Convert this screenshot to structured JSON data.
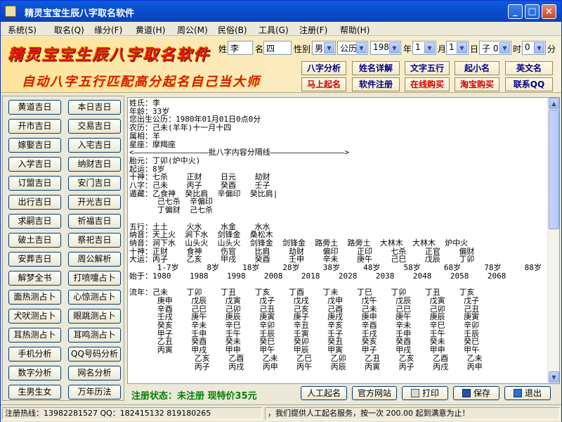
{
  "window": {
    "title": "精灵宝宝生辰八字取名软件"
  },
  "menu": [
    "系统(S)",
    "取名(Q)",
    "缘分(F)",
    "黄道(H)",
    "周公(M)",
    "民俗(B)",
    "工具(G)",
    "注册(F)",
    "帮助(H)"
  ],
  "banner": {
    "title": "精灵宝宝生辰八字取名软件",
    "subtitle": "自动八字五行匹配高分起名自己当大师"
  },
  "form": {
    "surname_label": "姓",
    "surname": "李",
    "name_label": "名",
    "name": "四",
    "gender_label": "性别",
    "gender": "男",
    "calendar": "公历",
    "year": "1980",
    "year_label": "年",
    "month": "1",
    "month_label": "月",
    "day": "1",
    "day_label": "日",
    "hour": "子 0",
    "hour_label": "时",
    "minute": "0",
    "minute_label": "分"
  },
  "actions": {
    "row1": [
      "八字分析",
      "姓名详解",
      "文字五行",
      "起小名",
      "英文名"
    ],
    "row2": [
      "马上起名",
      "软件注册",
      "在线购买",
      "淘宝购买",
      "联系QQ"
    ]
  },
  "left_buttons": [
    [
      "黄道吉日",
      "本日吉日"
    ],
    [
      "开市吉日",
      "交易吉日"
    ],
    [
      "嫁娶吉日",
      "入宅吉日"
    ],
    [
      "入学吉日",
      "纳财吉日"
    ],
    [
      "订盟吉日",
      "安门吉日"
    ],
    [
      "出行吉日",
      "开光吉日"
    ],
    [
      "求嗣吉日",
      "祈福吉日"
    ],
    [
      "破土吉日",
      "祭祀吉日"
    ],
    [
      "安葬吉日",
      "周公解析"
    ],
    [
      "解梦全书",
      "打喷嚏占卜"
    ],
    [
      "面热测占卜",
      "心惊测占卜"
    ],
    [
      "犬吠测占卜",
      "眼跳测占卜"
    ],
    [
      "耳热测占卜",
      "耳鸣测占卜"
    ],
    [
      "手机分析",
      "QQ号码分析"
    ],
    [
      "数字分析",
      "网名分析"
    ],
    [
      "生男生女",
      "万年历法"
    ]
  ],
  "result_text": "姓氏：李\n年龄：33岁\n您出生公历：1980年01月01日0点0分\n农历：己未(羊年)十一月十四\n属相：羊\n星座：摩羯座\n<————————————————批八字内容分隔线————————————————>\n胎元：丁卯(炉中火)\n起运：8岁\n十神：七杀    正财    日元    劫财\n八字：己未    丙子    癸酉    壬子\n遁藏：乙食神  癸比肩  辛偏印  癸比肩|\n      己七杀  辛偏印\n      丁偏财  己七杀\n\n五行：土土    火水    水金    水水\n纳音：天上火  涧下水  剑锋金  桑松木\n纳音：涧下水  山头火  山头火  剑锋金  剑锋金  路旁土  路旁土  大林木  大林木  炉中火\n十神：正财    食神    伤官    比肩    劫财    偏印    正印    七杀    正官    偏财\n大运：丙子    乙亥    甲戌    癸酉    壬申    辛未    庚午    己巳    戊辰    丁卯\n      1-7岁      8岁     18岁     28岁     38岁     48岁     58岁     68岁     78岁     88岁\n始于：1980    1988    1998    2008    2018    2028    2038    2048    2058    2068\n\n流年：己未    丁卯    丁丑    丁亥    丁酉    丁未    丁巳    丁卯    丁丑    丁亥\n      庚申    戊辰    戊寅    戊子    戊戌    戊申    戊午    戊辰    戊寅    戊子\n      辛酉    己巳    己卯    己丑    己亥    己酉    己未    己巳    己卯    己丑\n      壬戌    庚午    庚辰    庚寅    庚子    庚戌    庚申    庚午    庚辰    庚寅\n      癸亥    辛未    辛巳    辛卯    辛丑    辛亥    辛酉    辛未    辛巳    辛卯\n      甲子    壬申    壬午    壬辰    壬寅    壬子    壬戌    壬申    壬午    壬辰\n      乙丑    癸酉    癸未    癸巳    癸卯    癸丑    癸亥    癸酉    癸未    癸巳\n      丙寅    甲戌    甲申    甲午    甲辰    甲寅    甲子    甲戌    甲申    甲午\n              乙亥    乙酉    乙未    乙巳    乙卯    乙丑    乙亥    乙酉    乙未\n              丙子    丙戌    丙申    丙午    丙辰    丙寅    丙子    丙戌    丙申",
  "register": {
    "status_text": "注册状态：未注册  现特价35元"
  },
  "bottom_buttons": {
    "manual": "人工起名",
    "website": "官方网站",
    "print": "打印",
    "save": "保存",
    "exit": "退出"
  },
  "status": {
    "hotline": "注册热线：13982281527  QQ：182415132  819180265",
    "marquee": "，我们提供人工起名服务，按一次 200.00 起到满意为止！"
  }
}
